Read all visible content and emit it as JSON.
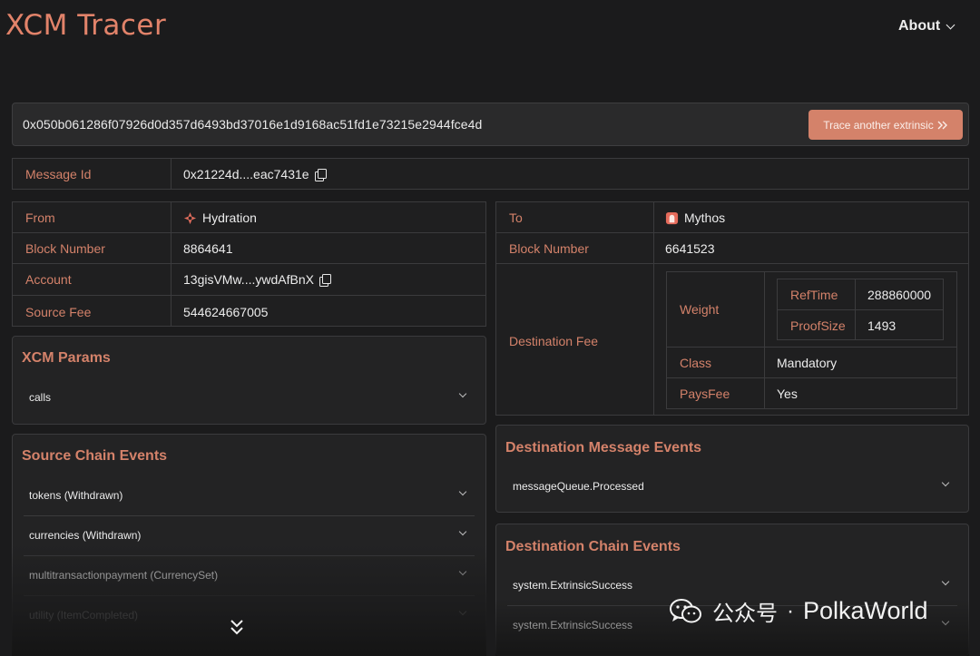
{
  "header": {
    "title": "XCM Tracer",
    "about_label": "About"
  },
  "search": {
    "value": "0x050b061286f07926d0d357d6493bd37016e1d9168ac51fd1e73215e2944fce4d",
    "button_label": "Trace another extrinsic"
  },
  "message": {
    "label": "Message Id",
    "value": "0x21224d....eac7431e"
  },
  "source": {
    "rows": [
      {
        "label": "From",
        "value": "Hydration",
        "icon": "hydration-icon"
      },
      {
        "label": "Block Number",
        "value": "8864641"
      },
      {
        "label": "Account",
        "value": "13gisVMw....ywdAfBnX",
        "icon": "copy-icon"
      },
      {
        "label": "Source Fee",
        "value": "544624667005"
      }
    ]
  },
  "destination": {
    "to_label": "To",
    "to_value": "Mythos",
    "to_icon": "mythos-icon",
    "block_label": "Block Number",
    "block_value": "6641523",
    "fee_label": "Destination Fee",
    "fee": {
      "weight_label": "Weight",
      "ref_time_label": "RefTime",
      "ref_time_value": "288860000",
      "proof_size_label": "ProofSize",
      "proof_size_value": "1493",
      "class_label": "Class",
      "class_value": "Mandatory",
      "pays_fee_label": "PaysFee",
      "pays_fee_value": "Yes"
    }
  },
  "xcm_params": {
    "title": "XCM Params",
    "items": [
      "calls"
    ]
  },
  "source_events": {
    "title": "Source Chain Events",
    "items": [
      "tokens (Withdrawn)",
      "currencies (Withdrawn)",
      "multitransactionpayment (CurrencySet)",
      "utility (ItemCompleted)"
    ]
  },
  "dest_message_events": {
    "title": "Destination Message Events",
    "items": [
      "messageQueue.Processed"
    ]
  },
  "dest_chain_events": {
    "title": "Destination Chain Events",
    "items": [
      "system.ExtrinsicSuccess",
      "system.ExtrinsicSuccess"
    ]
  },
  "watermark": {
    "platform": "公众号",
    "separator": "·",
    "name": "PolkaWorld"
  },
  "colors": {
    "accent": "#d4826a",
    "background": "#1b1b1c",
    "panel": "#232324",
    "border": "#3b3b3d"
  }
}
